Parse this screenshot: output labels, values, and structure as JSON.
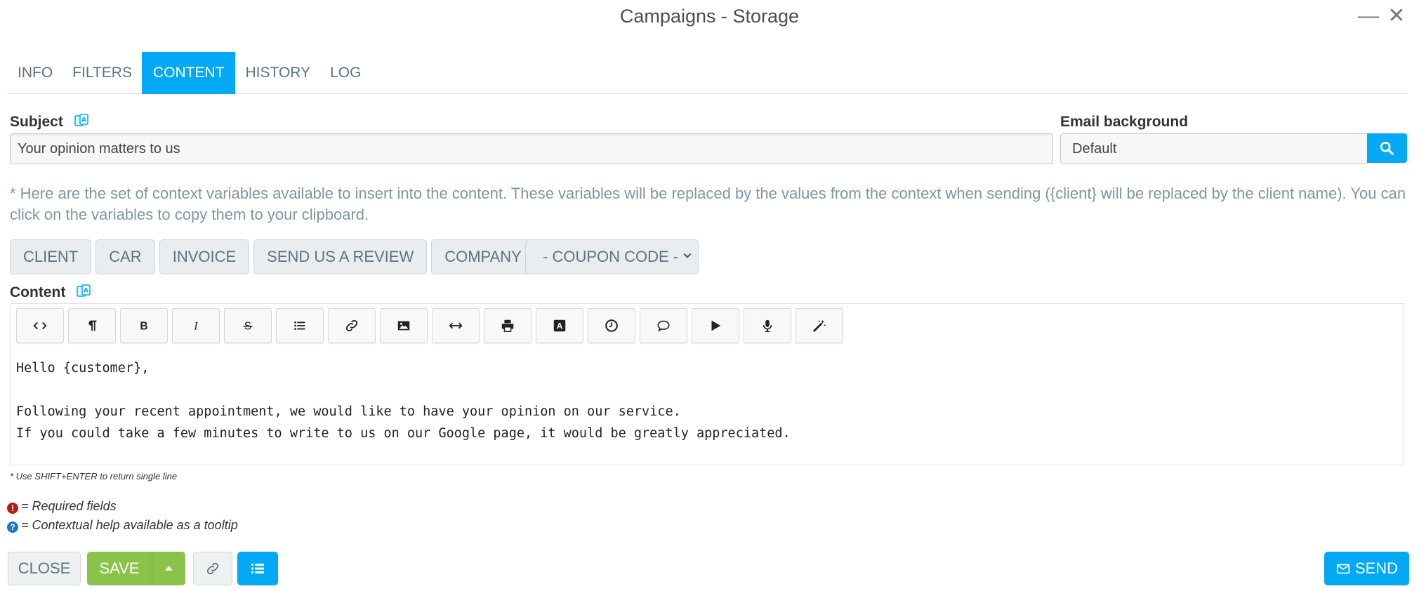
{
  "window": {
    "title": "Campaigns - Storage",
    "minimize_icon": "minimize-icon",
    "close_icon": "close-icon"
  },
  "tabs": [
    {
      "label": "INFO",
      "active": false
    },
    {
      "label": "FILTERS",
      "active": false
    },
    {
      "label": "CONTENT",
      "active": true
    },
    {
      "label": "HISTORY",
      "active": false
    },
    {
      "label": "LOG",
      "active": false
    }
  ],
  "subject": {
    "label": "Subject",
    "value": "Your opinion matters to us",
    "translate_icon": "translate-icon"
  },
  "email_background": {
    "label": "Email background",
    "value": "Default",
    "search_icon": "search-icon"
  },
  "context_help": "* Here are the set of context variables available to insert into the content. These variables will be replaced by the values from the context when sending ({client} will be replaced by the client name). You can click on the variables to copy them to your clipboard.",
  "variables": [
    "CLIENT",
    "CAR",
    "INVOICE",
    "SEND US A REVIEW",
    "COMPANY"
  ],
  "coupon_select": {
    "value": "- COUPON CODE -"
  },
  "content": {
    "label": "Content",
    "toolbar": [
      "code-view-icon",
      "paragraph-icon",
      "bold-icon",
      "italic-icon",
      "strikethrough-icon",
      "list-icon",
      "link-icon",
      "image-icon",
      "horizontal-rule-icon",
      "print-icon",
      "font-icon",
      "clock-icon",
      "comment-icon",
      "play-icon",
      "microphone-icon",
      "magic-wand-icon"
    ],
    "body": "Hello {customer},\n\nFollowing your recent appointment, we would like to have your opinion on our service.\nIf you could take a few minutes to write to us on our Google page, it would be greatly appreciated."
  },
  "shift_note": "* Use SHIFT+ENTER to return single line",
  "legend": {
    "required": "= Required fields",
    "help": "= Contextual help available as a tooltip"
  },
  "footer": {
    "close_label": "CLOSE",
    "save_label": "SAVE",
    "send_label": "SEND"
  },
  "colors": {
    "accent": "#03a9f4",
    "save_green": "#8bc34a",
    "required_red": "#b71c1c",
    "help_blue": "#1976d2"
  }
}
